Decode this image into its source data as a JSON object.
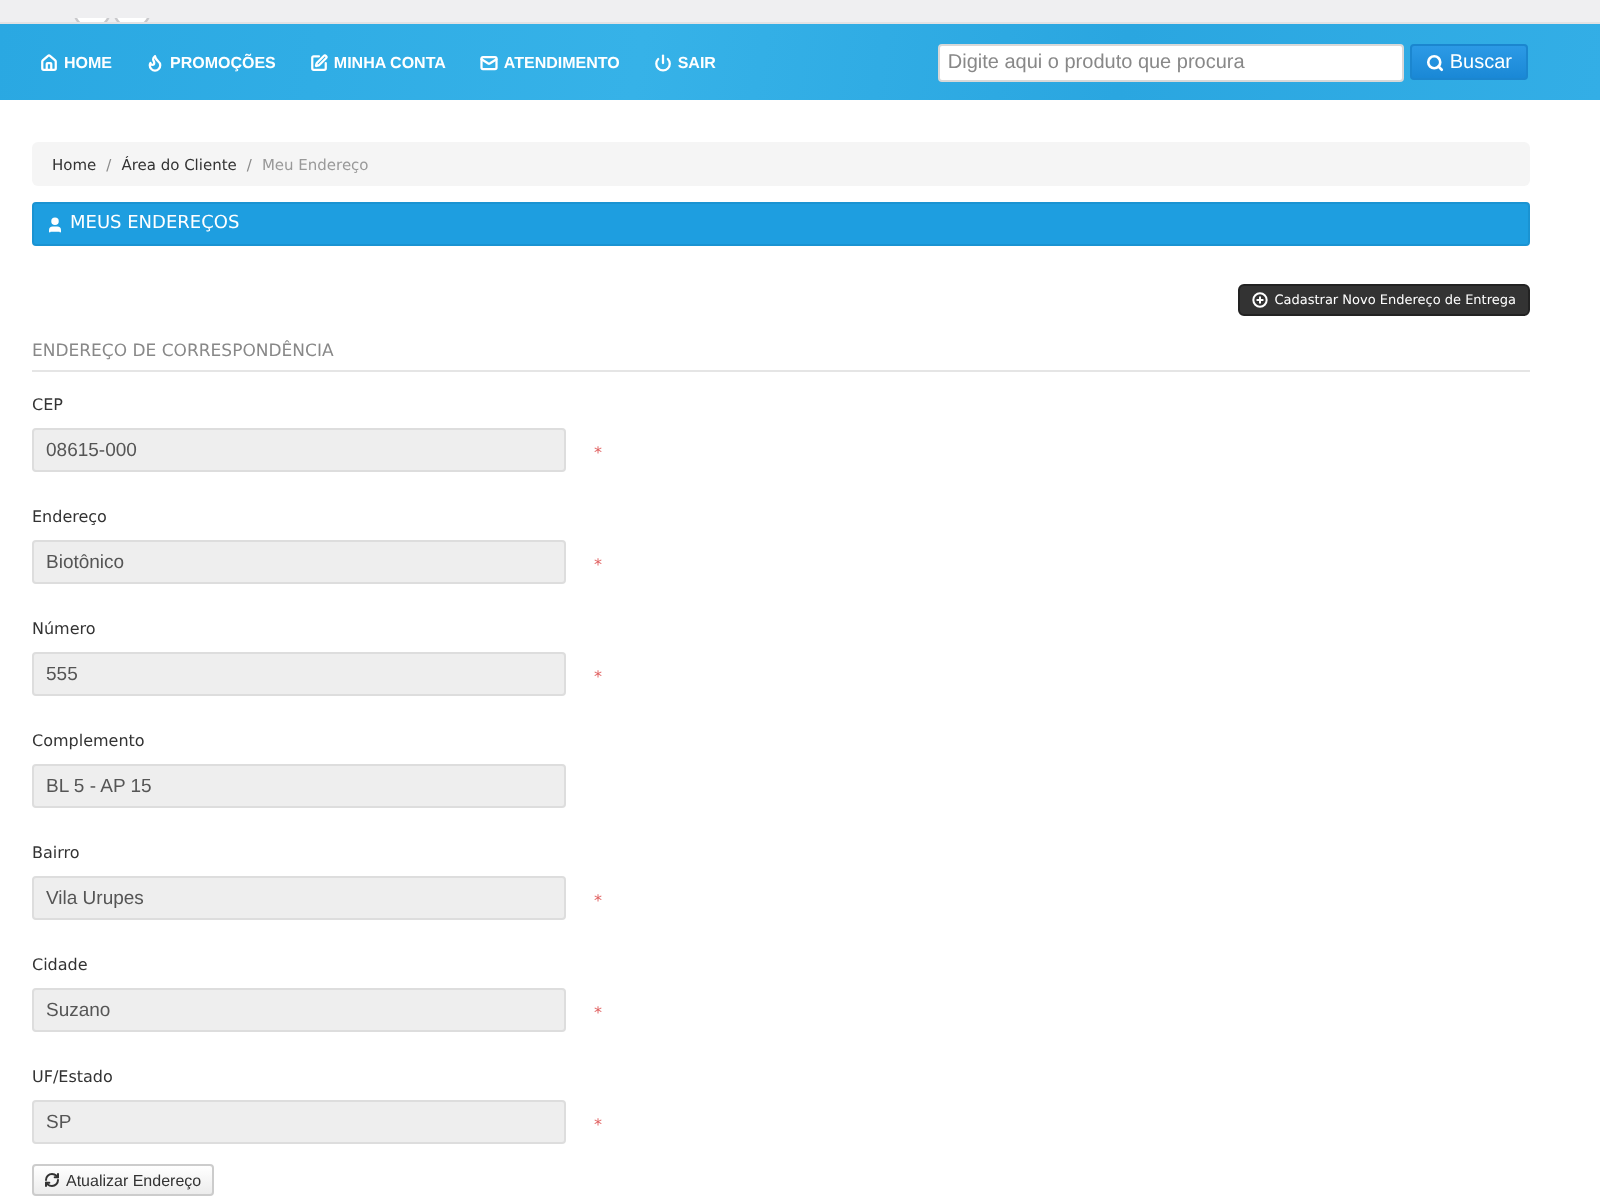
{
  "nav": {
    "items": [
      {
        "label": "HOME"
      },
      {
        "label": "PROMOÇÕES"
      },
      {
        "label": "MINHA CONTA"
      },
      {
        "label": "ATENDIMENTO"
      },
      {
        "label": "SAIR"
      }
    ]
  },
  "search": {
    "placeholder": "Digite aqui o produto que procura",
    "button": "Buscar"
  },
  "breadcrumb": {
    "separator": "/",
    "items": [
      {
        "label": "Home",
        "current": false
      },
      {
        "label": "Área do Cliente",
        "current": false
      },
      {
        "label": "Meu Endereço",
        "current": true
      }
    ]
  },
  "panel": {
    "title": "MEUS ENDEREÇOS"
  },
  "new_address_button": "Cadastrar Novo Endereço de Entrega",
  "section_title": "ENDEREÇO DE CORRESPONDÊNCIA",
  "required_mark": "*",
  "fields": [
    {
      "label": "CEP",
      "value": "08615-000",
      "required": true,
      "disabled": true
    },
    {
      "label": "Endereço",
      "value": "Biotônico",
      "required": true,
      "disabled": true
    },
    {
      "label": "Número",
      "value": "555",
      "required": true,
      "disabled": true
    },
    {
      "label": "Complemento",
      "value": "BL 5 - AP 15",
      "required": false,
      "disabled": true
    },
    {
      "label": "Bairro",
      "value": "Vila Urupes",
      "required": true,
      "disabled": true
    },
    {
      "label": "Cidade",
      "value": "Suzano",
      "required": true,
      "disabled": true
    },
    {
      "label": "UF/Estado",
      "value": "SP",
      "required": true,
      "disabled": true
    }
  ],
  "update_button": "Atualizar Endereço"
}
